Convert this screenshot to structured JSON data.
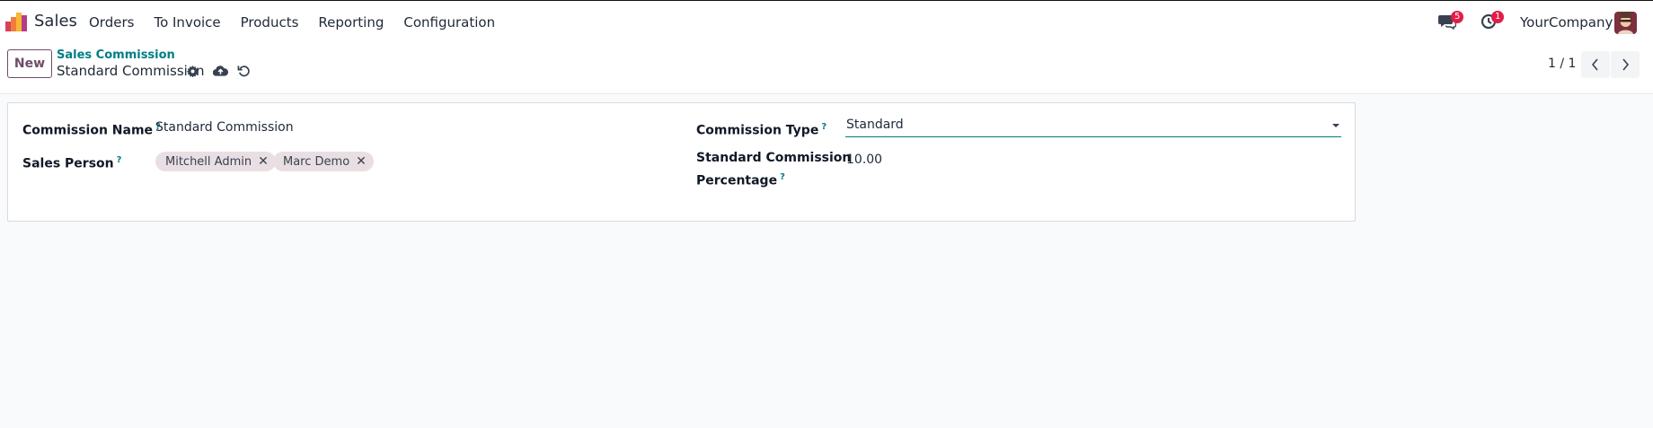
{
  "nav": {
    "app_name": "Sales",
    "menu": [
      "Orders",
      "To Invoice",
      "Products",
      "Reporting",
      "Configuration"
    ],
    "chat_count": "5",
    "activity_count": "1",
    "company": "YourCompany"
  },
  "control": {
    "new_label": "New",
    "breadcrumb_parent": "Sales Commission",
    "breadcrumb_current": "Standard Commission",
    "pager": "1 / 1"
  },
  "form": {
    "commission_name_label": "Commission Name",
    "commission_name_value": "Standard Commission",
    "sales_person_label": "Sales Person",
    "sales_persons": [
      "Mitchell Admin",
      "Marc Demo"
    ],
    "commission_type_label": "Commission Type",
    "commission_type_value": "Standard",
    "std_pct_label_line1": "Standard Commission",
    "std_pct_label_line2": "Percentage",
    "std_pct_value": "10.00",
    "help_mark": "?"
  },
  "colors": {
    "brand": "#714B67",
    "accent": "#017e84",
    "badge": "#e11d48"
  },
  "icons": [
    "app-logo-icon",
    "chat-icon",
    "activity-clock-icon",
    "gear-icon",
    "cloud-upload-icon",
    "discard-icon",
    "chevron-left-icon",
    "chevron-right-icon",
    "close-icon",
    "caret-down-icon"
  ]
}
